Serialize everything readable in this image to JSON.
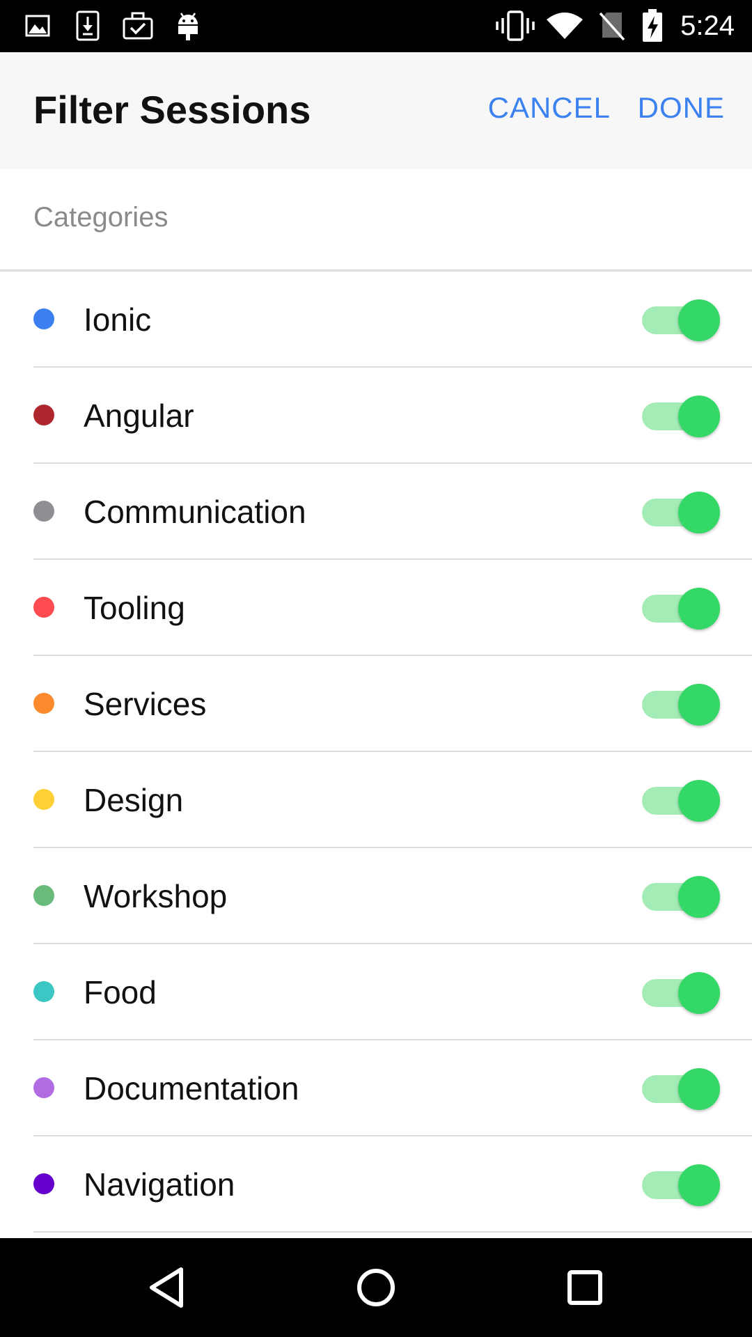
{
  "status_bar": {
    "time": "5:24",
    "left_icons": [
      "image-icon",
      "download-icon",
      "briefcase-check-icon",
      "android-icon"
    ],
    "right_icons": [
      "vibrate-icon",
      "wifi-icon",
      "no-sim-icon",
      "battery-charging-icon"
    ]
  },
  "header": {
    "title": "Filter Sessions",
    "cancel_label": "CANCEL",
    "done_label": "DONE"
  },
  "section": {
    "label": "Categories"
  },
  "categories": [
    {
      "label": "Ionic",
      "color": "#3b7ff0",
      "enabled": true
    },
    {
      "label": "Angular",
      "color": "#b0262f",
      "enabled": true
    },
    {
      "label": "Communication",
      "color": "#8e8e93",
      "enabled": true
    },
    {
      "label": "Tooling",
      "color": "#fe4c52",
      "enabled": true
    },
    {
      "label": "Services",
      "color": "#fd8b2d",
      "enabled": true
    },
    {
      "label": "Design",
      "color": "#fed035",
      "enabled": true
    },
    {
      "label": "Workshop",
      "color": "#69bb7b",
      "enabled": true
    },
    {
      "label": "Food",
      "color": "#3bc7c4",
      "enabled": true
    },
    {
      "label": "Documentation",
      "color": "#b16be3",
      "enabled": true
    },
    {
      "label": "Navigation",
      "color": "#6600cc",
      "enabled": true
    }
  ],
  "nav_bar": {
    "icons": [
      "back-icon",
      "home-icon",
      "recents-icon"
    ]
  },
  "colors": {
    "accent": "#3b82f0",
    "toggle_on_knob": "#33d866",
    "toggle_on_track": "#a4ecb6"
  }
}
